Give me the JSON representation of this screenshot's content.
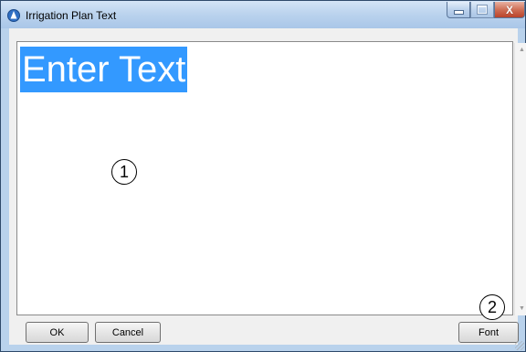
{
  "window": {
    "title": "Irrigation Plan Text",
    "close_glyph": "X"
  },
  "editor": {
    "text": "Enter Text",
    "selected": true
  },
  "callouts": [
    "1",
    "2"
  ],
  "buttons": {
    "ok": "OK",
    "cancel": "Cancel",
    "font": "Font"
  },
  "icons": {
    "app": "app-icon",
    "minimize": "minimize-icon",
    "maximize": "maximize-icon",
    "close": "close-icon"
  },
  "colors": {
    "selection": "#3399ff",
    "titlebar": "#bcd4ee",
    "close_button": "#cf6f56"
  }
}
